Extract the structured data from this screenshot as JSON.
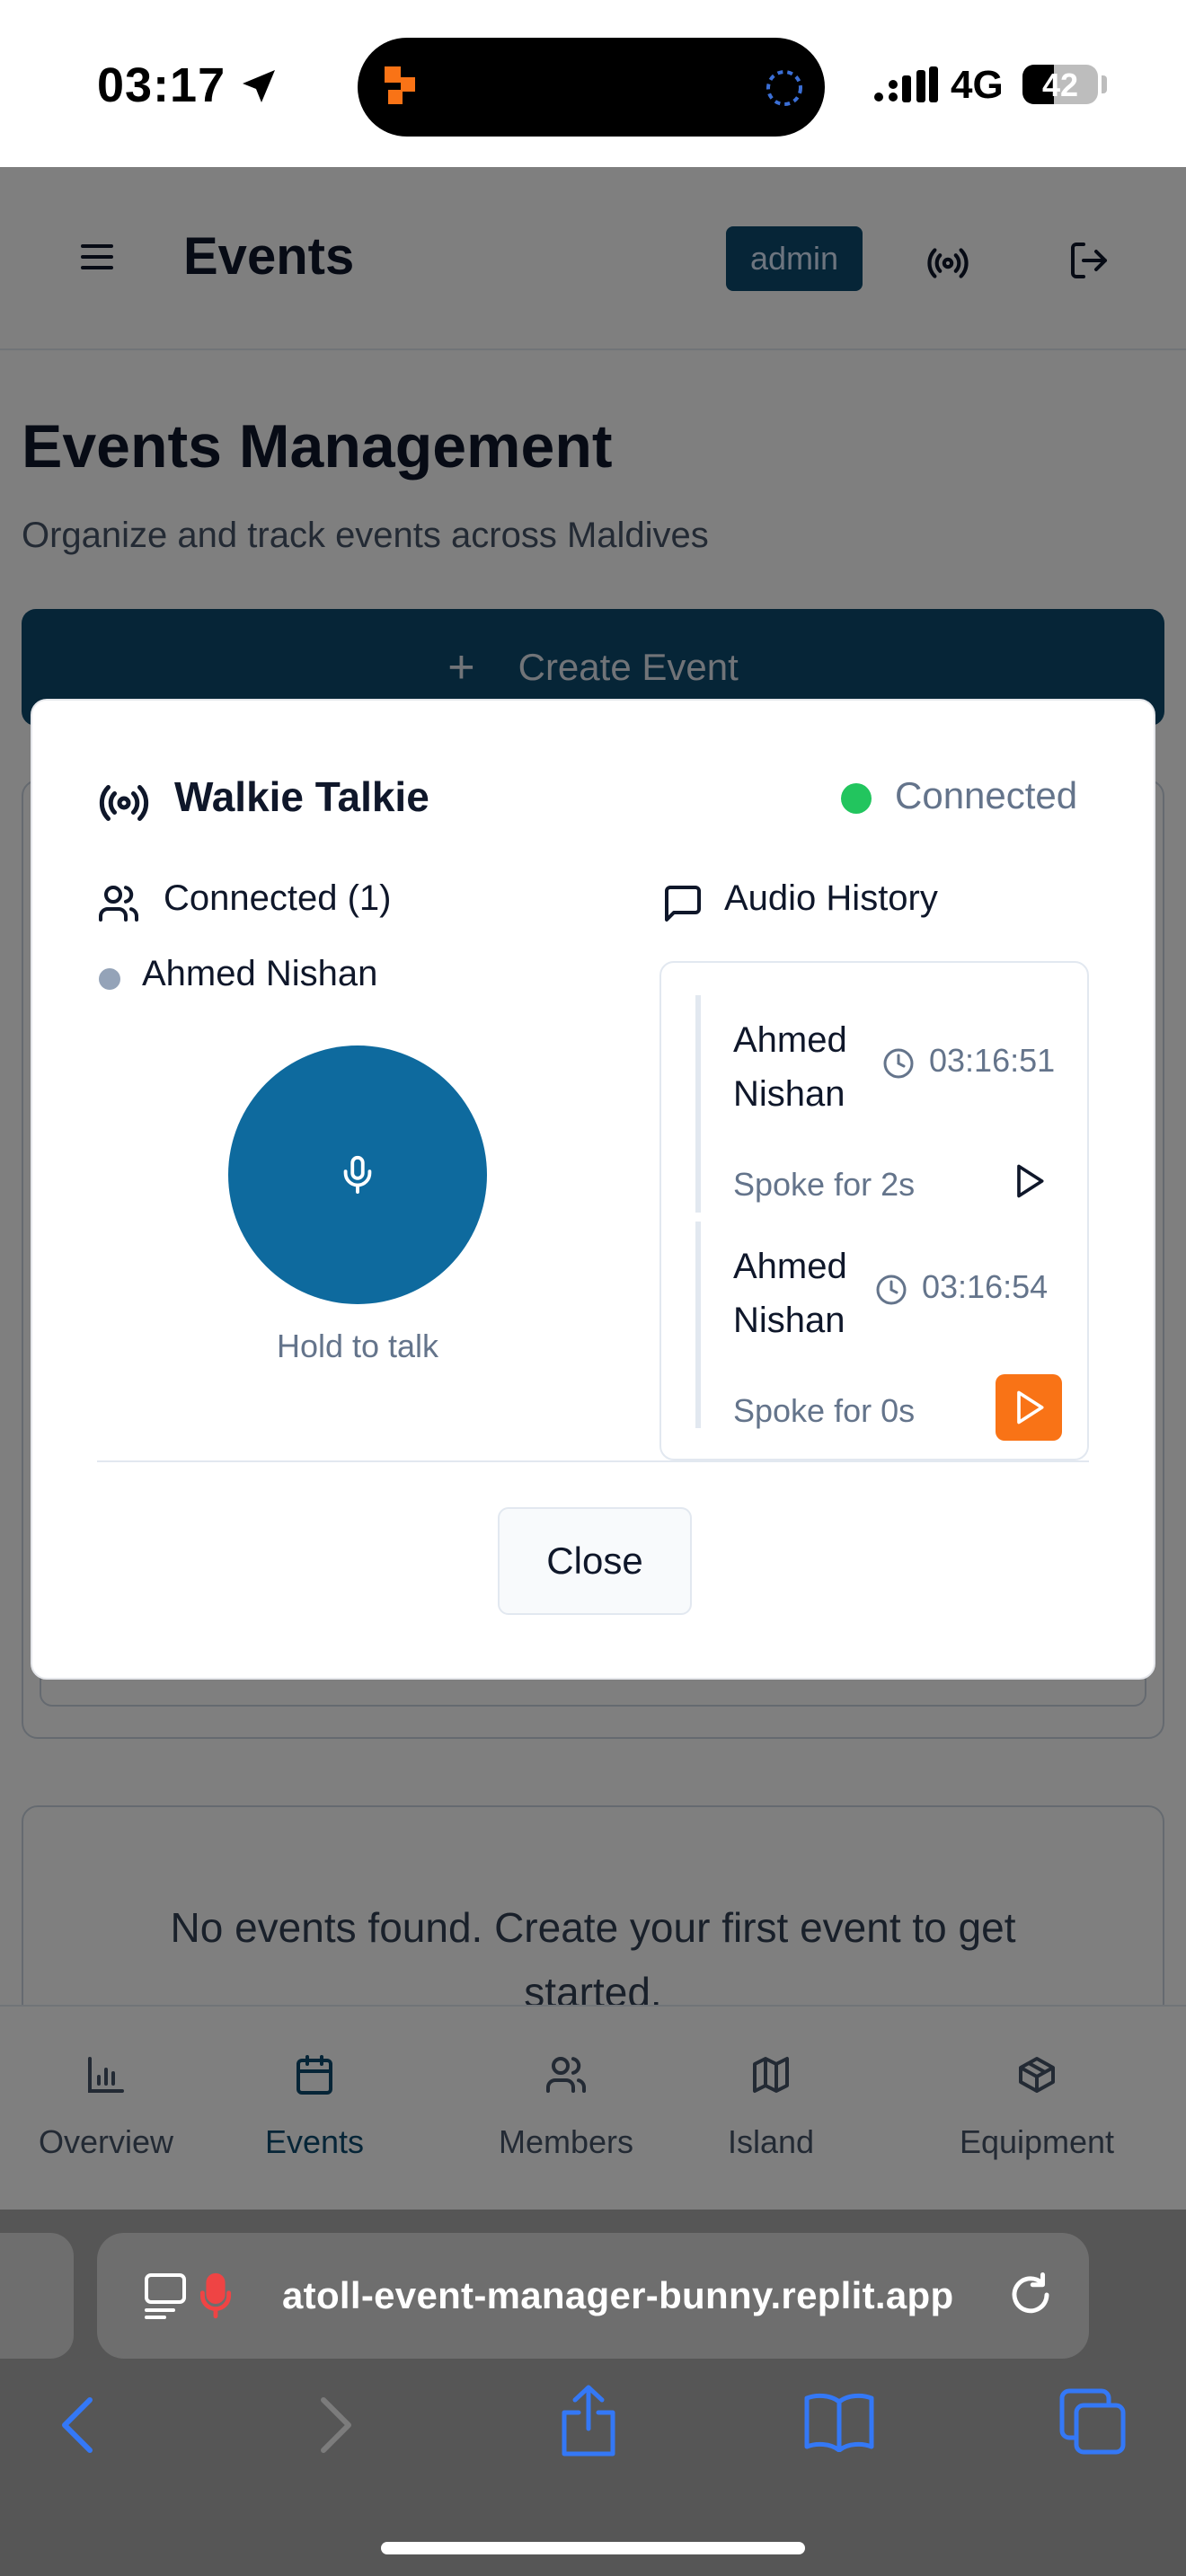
{
  "status_bar": {
    "time": "03:17",
    "network": "4G",
    "battery": "42",
    "battery_level": 0.42
  },
  "header": {
    "title": "Events",
    "role_badge": "admin"
  },
  "page": {
    "title": "Events Management",
    "subtitle": "Organize and track events across Maldives",
    "create_button": "Create Event",
    "empty_message": "No events found. Create your first event to get started."
  },
  "tabs": [
    {
      "label": "Overview",
      "icon": "bar-chart-icon",
      "active": false
    },
    {
      "label": "Events",
      "icon": "calendar-icon",
      "active": true
    },
    {
      "label": "Members",
      "icon": "users-icon",
      "active": false
    },
    {
      "label": "Island",
      "icon": "map-icon",
      "active": false
    },
    {
      "label": "Equipment",
      "icon": "package-icon",
      "active": false
    }
  ],
  "modal": {
    "title": "Walkie Talkie",
    "status": "Connected",
    "connected_heading": "Connected (1)",
    "connected_users": [
      "Ahmed Nishan"
    ],
    "talk_label": "Hold to talk",
    "history_heading": "Audio History",
    "history": [
      {
        "name_line1": "Ahmed",
        "name_line2": "Nishan",
        "time": "03:16:51",
        "duration": "Spoke for 2s"
      },
      {
        "name_line1": "Ahmed",
        "name_line2": "Nishan",
        "time": "03:16:54",
        "duration": "Spoke for 0s"
      }
    ],
    "close_button": "Close"
  },
  "browser": {
    "url": "atoll-event-manager-bunny.replit.app"
  },
  "colors": {
    "primary": "#0c4a6e",
    "button_blue": "#0e6a9e",
    "accent_orange": "#f97316",
    "status_green": "#22c55e",
    "safari_blue": "#3478f6"
  }
}
